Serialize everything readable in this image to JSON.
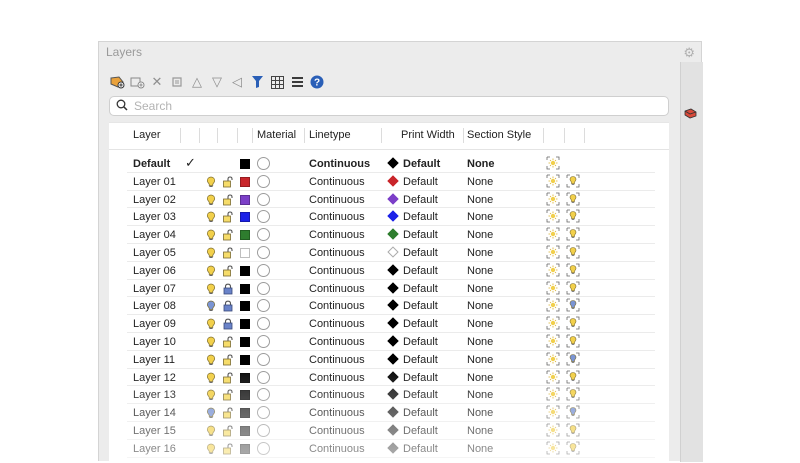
{
  "panel": {
    "title": "Layers"
  },
  "toolbar": {
    "icons": [
      "add-layer-icon",
      "add-layer-folder-icon",
      "delete-layer-icon",
      "purge-icon",
      "move-up-icon",
      "move-down-icon",
      "collapse-icon",
      "filter-icon",
      "table-view-icon",
      "list-view-icon",
      "help-icon"
    ]
  },
  "search": {
    "placeholder": "Search",
    "value": ""
  },
  "columns": {
    "layer": "Layer",
    "material": "Material",
    "linetype": "Linetype",
    "print_width": "Print Width",
    "section_style": "Section Style"
  },
  "colors": {
    "bulb_yellow": "#f2d04b",
    "bulb_blue": "#7b95d4",
    "lock_blue": "#6a83c9"
  },
  "rows": [
    {
      "name": "Default",
      "current": true,
      "color": "#000000",
      "linetype": "Continuous",
      "print_color": "#000000",
      "print_width": "Default",
      "section_style": "None",
      "bold": true
    },
    {
      "name": "Layer 01",
      "bulb": "yellow",
      "lock": "open",
      "color": "#c9262b",
      "linetype": "Continuous",
      "print_color": "#c9262b",
      "print_width": "Default",
      "section_style": "None",
      "bulb2": "yellow"
    },
    {
      "name": "Layer 02",
      "bulb": "yellow",
      "lock": "open",
      "color": "#7c3fc8",
      "linetype": "Continuous",
      "print_color": "#7c3fc8",
      "print_width": "Default",
      "section_style": "None",
      "bulb2": "yellow"
    },
    {
      "name": "Layer 03",
      "bulb": "yellow",
      "lock": "open",
      "color": "#1c22e8",
      "linetype": "Continuous",
      "print_color": "#1c22e8",
      "print_width": "Default",
      "section_style": "None",
      "bulb2": "yellow"
    },
    {
      "name": "Layer 04",
      "bulb": "yellow",
      "lock": "open",
      "color": "#2e7d2e",
      "linetype": "Continuous",
      "print_color": "#2e7d2e",
      "print_width": "Default",
      "section_style": "None",
      "bulb2": "yellow"
    },
    {
      "name": "Layer 05",
      "bulb": "yellow",
      "lock": "open",
      "color": "#ffffff",
      "linetype": "Continuous",
      "print_color": "#ffffff",
      "print_width": "Default",
      "section_style": "None",
      "bulb2": "yellow"
    },
    {
      "name": "Layer 06",
      "bulb": "yellow",
      "lock": "open",
      "color": "#000000",
      "linetype": "Continuous",
      "print_color": "#000000",
      "print_width": "Default",
      "section_style": "None",
      "bulb2": "yellow"
    },
    {
      "name": "Layer 07",
      "bulb": "yellow",
      "lock": "closed",
      "color": "#000000",
      "linetype": "Continuous",
      "print_color": "#000000",
      "print_width": "Default",
      "section_style": "None",
      "bulb2": "yellow"
    },
    {
      "name": "Layer 08",
      "bulb": "blue",
      "lock": "closed",
      "color": "#000000",
      "linetype": "Continuous",
      "print_color": "#000000",
      "print_width": "Default",
      "section_style": "None",
      "bulb2": "blue"
    },
    {
      "name": "Layer 09",
      "bulb": "yellow",
      "lock": "closed",
      "color": "#000000",
      "linetype": "Continuous",
      "print_color": "#000000",
      "print_width": "Default",
      "section_style": "None",
      "bulb2": "yellow"
    },
    {
      "name": "Layer 10",
      "bulb": "yellow",
      "lock": "open",
      "color": "#000000",
      "linetype": "Continuous",
      "print_color": "#000000",
      "print_width": "Default",
      "section_style": "None",
      "bulb2": "yellow"
    },
    {
      "name": "Layer 11",
      "bulb": "yellow",
      "lock": "open",
      "color": "#000000",
      "linetype": "Continuous",
      "print_color": "#000000",
      "print_width": "Default",
      "section_style": "None",
      "bulb2": "blue"
    },
    {
      "name": "Layer 12",
      "bulb": "yellow",
      "lock": "open",
      "color": "#111111",
      "linetype": "Continuous",
      "print_color": "#111111",
      "print_width": "Default",
      "section_style": "None",
      "bulb2": "yellow"
    },
    {
      "name": "Layer 13",
      "bulb": "yellow",
      "lock": "open",
      "color": "#222222",
      "linetype": "Continuous",
      "print_color": "#222222",
      "print_width": "Default",
      "section_style": "None",
      "bulb2": "yellow"
    },
    {
      "name": "Layer 14",
      "bulb": "blue",
      "lock": "open",
      "color": "#333333",
      "linetype": "Continuous",
      "print_color": "#333333",
      "print_width": "Default",
      "section_style": "None",
      "bulb2": "blue"
    },
    {
      "name": "Layer 15",
      "bulb": "yellow",
      "lock": "open",
      "color": "#444444",
      "linetype": "Continuous",
      "print_color": "#444444",
      "print_width": "Default",
      "section_style": "None",
      "bulb2": "yellow"
    },
    {
      "name": "Layer 16",
      "bulb": "yellow",
      "lock": "open",
      "color": "#555555",
      "linetype": "Continuous",
      "print_color": "#555555",
      "print_width": "Default",
      "section_style": "None",
      "bulb2": "yellow"
    }
  ]
}
